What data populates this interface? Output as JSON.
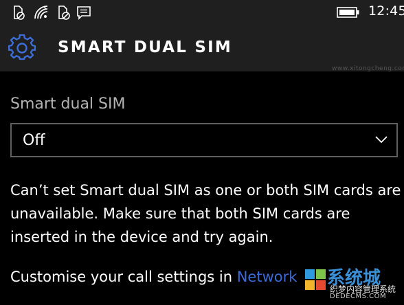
{
  "status_bar": {
    "time": "12:45",
    "icons": [
      "no-sim-icon",
      "wifi-icon",
      "no-sim-icon-2",
      "message-icon"
    ],
    "battery_icon": "battery-icon"
  },
  "header": {
    "icon": "gear-icon",
    "title": "SMART DUAL SIM"
  },
  "watermark": {
    "top_text": "www.xitongcheng.com",
    "logo_main": "系统城",
    "logo_sub": "织梦内容管理系统",
    "logo_url": "DEDECMS.COM",
    "logo_url_2": "xitongcheng.com"
  },
  "smart_dual_sim": {
    "label": "Smart dual SIM",
    "selected_value": "Off"
  },
  "message": {
    "text": "Can’t set Smart dual SIM as one or both SIM cards are unavailable. Make sure that both SIM cards are inserted in the device and try again."
  },
  "call_settings": {
    "prefix": "Customise your call settings in ",
    "link": "Network"
  },
  "colors": {
    "background": "#000000",
    "bar": "#1f1f1f",
    "accent": "#3c6bd8",
    "gear": "#3d6fd8",
    "label": "#b3b3b3"
  }
}
